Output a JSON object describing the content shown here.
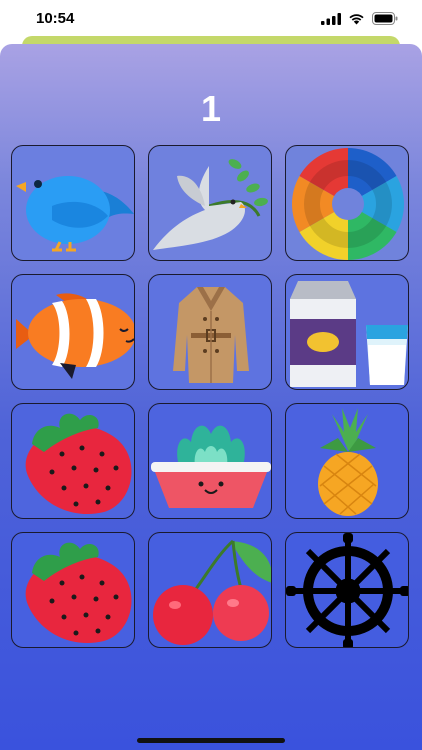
{
  "status_bar": {
    "time": "10:54"
  },
  "game": {
    "score": "1",
    "tiles": [
      {
        "icon": "blue-bird-icon"
      },
      {
        "icon": "dove-with-olive-branch-icon"
      },
      {
        "icon": "color-wheel-icon"
      },
      {
        "icon": "clownfish-icon"
      },
      {
        "icon": "trench-coat-icon"
      },
      {
        "icon": "milk-carton-and-glass-icon"
      },
      {
        "icon": "strawberry-icon"
      },
      {
        "icon": "potted-plant-icon"
      },
      {
        "icon": "pineapple-icon"
      },
      {
        "icon": "strawberry-icon"
      },
      {
        "icon": "cherries-icon"
      },
      {
        "icon": "ship-wheel-icon"
      }
    ]
  }
}
